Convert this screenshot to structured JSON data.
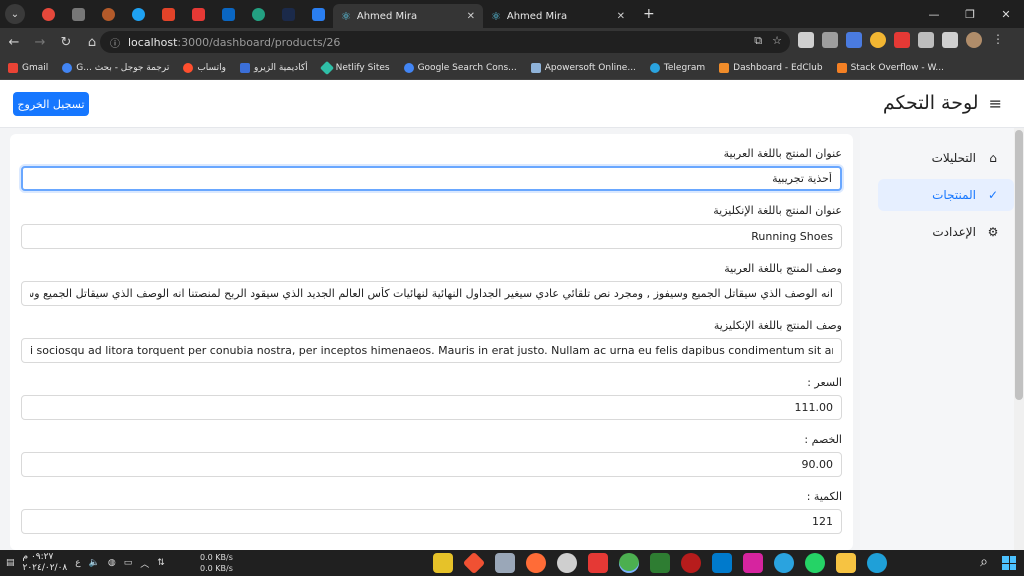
{
  "browser": {
    "tabs": [
      {
        "title": "Ahmed Mira",
        "active": true,
        "close": "✕"
      },
      {
        "title": "Ahmed Mira",
        "active": false,
        "close": "✕"
      }
    ],
    "new_tab": "+",
    "url_host": "localhost",
    "url_path": ":3000/dashboard/products/26",
    "bookmarks": [
      {
        "label": "Gmail",
        "color": "#ea4335"
      },
      {
        "label": "G... ترجمة جوجل - بحث",
        "color": "#4285f4"
      },
      {
        "label": "واتساب",
        "color": "#ff4f2e"
      },
      {
        "label": "أكاديمية الزيرو",
        "color": "#3b6fd8"
      },
      {
        "label": "Netlify Sites",
        "color": "#2fbfa7"
      },
      {
        "label": "Google Search Cons...",
        "color": "#4285f4"
      },
      {
        "label": "Apowersoft Online...",
        "color": "#8fb3d9"
      },
      {
        "label": "Telegram",
        "color": "#2aa3df"
      },
      {
        "label": "Dashboard - EdClub",
        "color": "#f08c2a"
      },
      {
        "label": "Stack Overflow - W...",
        "color": "#f48024"
      }
    ]
  },
  "header": {
    "title": "لوحة التحكم",
    "logout_label": "تسجيل الخروج"
  },
  "sidebar": {
    "items": [
      {
        "label": "التحليلات",
        "icon": "home-icon",
        "active": false
      },
      {
        "label": "المنتجات",
        "icon": "check-icon",
        "active": true
      },
      {
        "label": "الإعدادت",
        "icon": "gear-icon",
        "active": false
      }
    ]
  },
  "form": {
    "title_ar": {
      "label": "عنوان المنتج باللغة العربية",
      "value": "أحذية تجريبية"
    },
    "title_en": {
      "label": "عنوان المنتج باللغة الإنكليزية",
      "value": "Running Shoes"
    },
    "desc_ar": {
      "label": "وصف المنتج باللغة العربية",
      "value": "انه الوصف الذي سيقاتل الجميع وسيفوز , ومجرد نص تلقائي عادي سيغير الجداول النهائية لنهائيات كأس العالم الجديد الذي سيقود الربح لمنصتنا انه الوصف الذي سيقاتل الجميع وسيفوز , وم"
    },
    "desc_en": {
      "label": "وصف المنتج باللغة الإنكليزية",
      "value": "i sociosqu ad litora torquent per conubia nostra, per inceptos himenaeos. Mauris in erat justo. Nullam ac urna eu felis dapibus condimentum sit amet a augue. Sed non neque elit sed"
    },
    "price": {
      "label": "السعر :",
      "value": "111.00"
    },
    "discount": {
      "label": "الخصم :",
      "value": "90.00"
    },
    "quantity": {
      "label": "الكمية :",
      "value": "121"
    }
  },
  "taskbar": {
    "time": "٠٩:٢٧ م",
    "date": "٢٠٢٤/٠٢/٠٨",
    "lang": "ع",
    "speed_up": "0.0 KB/s",
    "speed_down": "0.0 KB/s"
  }
}
